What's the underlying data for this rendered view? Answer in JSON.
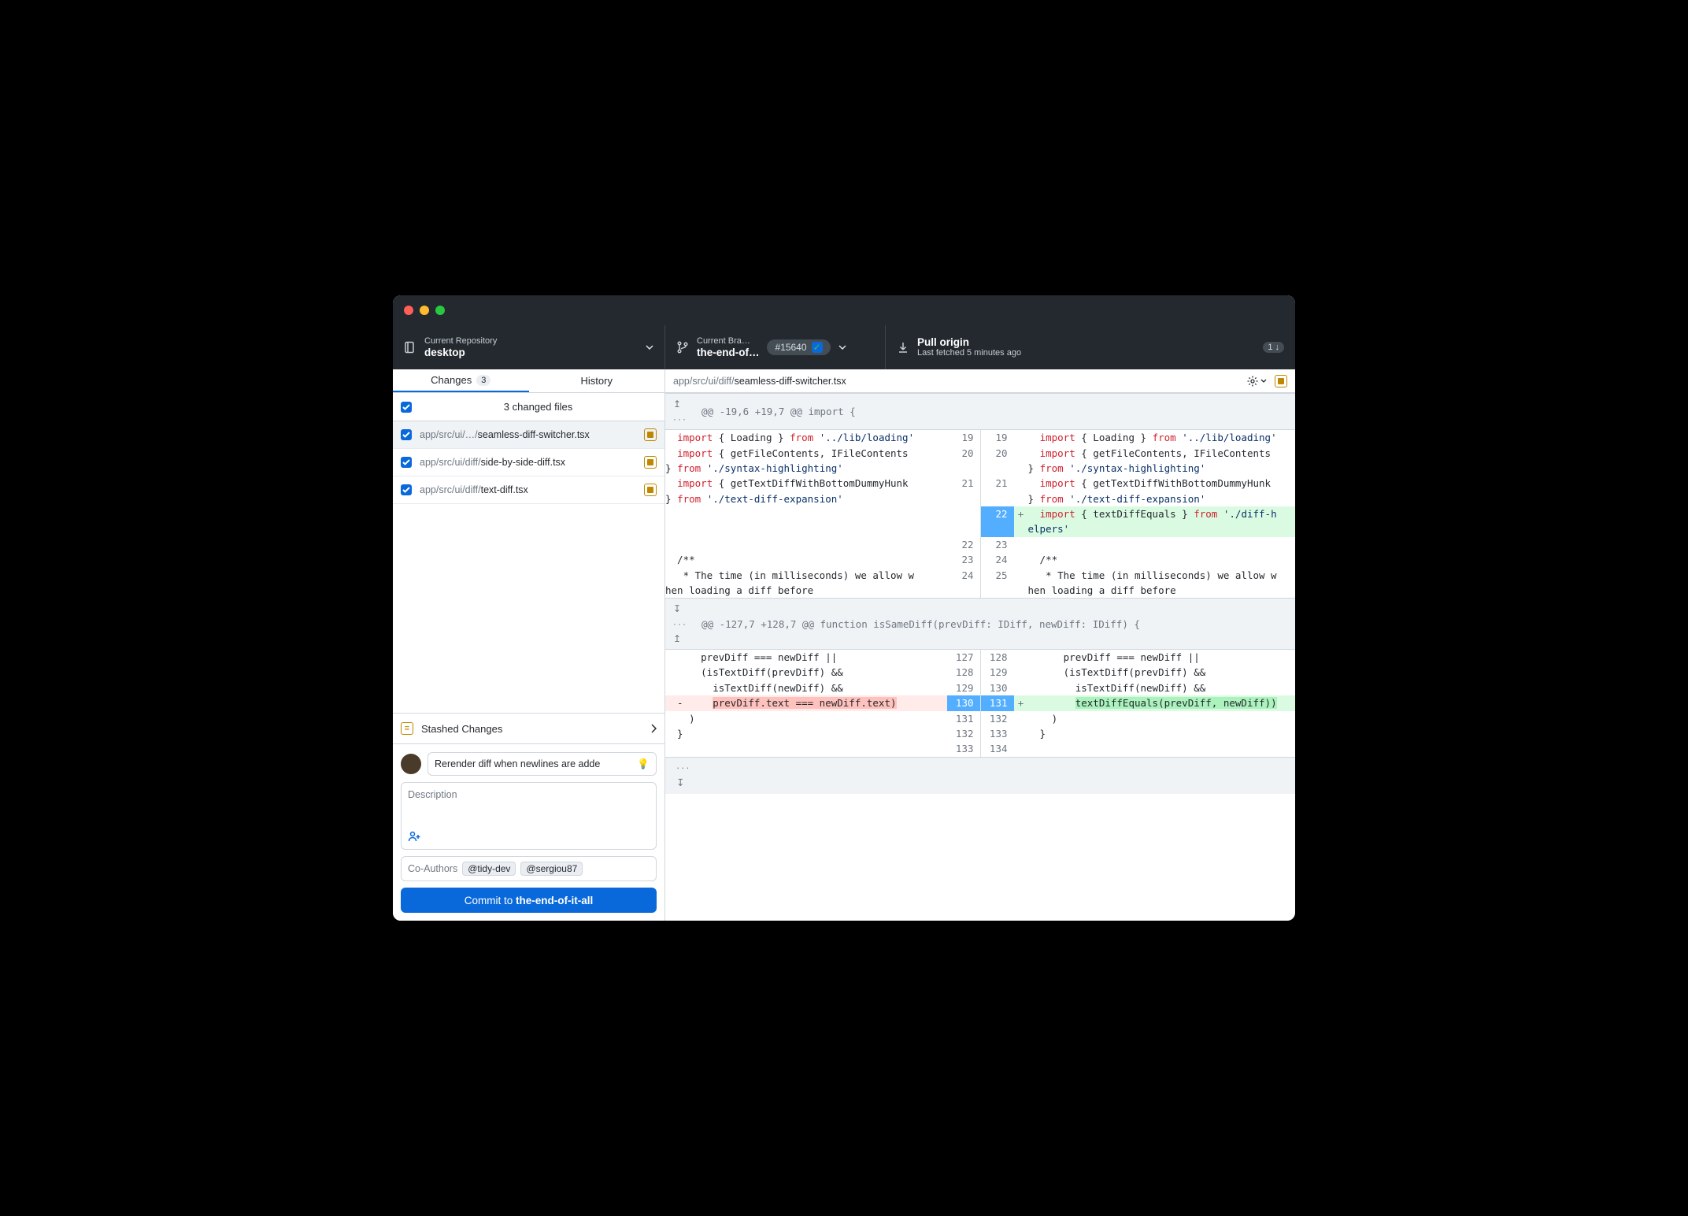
{
  "toolbar": {
    "repo_label": "Current Repository",
    "repo_name": "desktop",
    "branch_label": "Current Bra…",
    "branch_name": "the-end-of…",
    "pr_number": "#15640",
    "pull_label": "Pull origin",
    "pull_sub": "Last fetched 5 minutes ago",
    "pull_badge": "1"
  },
  "tabs": {
    "changes": "Changes",
    "changes_count": "3",
    "history": "History"
  },
  "files": {
    "header": "3 changed files",
    "items": [
      {
        "dir": "app/src/ui/…/",
        "name": "seamless-diff-switcher.tsx"
      },
      {
        "dir": "app/src/ui/diff/",
        "name": "side-by-side-diff.tsx"
      },
      {
        "dir": "app/src/ui/diff/",
        "name": "text-diff.tsx"
      }
    ]
  },
  "stash": "Stashed Changes",
  "commit": {
    "summary": "Rerender diff when newlines are adde",
    "desc_placeholder": "Description",
    "coauthors_label": "Co-Authors",
    "coauthors": [
      "@tidy-dev",
      "@sergiou87"
    ],
    "button_prefix": "Commit to ",
    "button_branch": "the-end-of-it-all"
  },
  "diff": {
    "path_dir": "app/src/ui/diff/",
    "path_file": "seamless-diff-switcher.tsx",
    "hunk1": "@@ -19,6 +19,7 @@ import {",
    "hunk2": "@@ -127,7 +128,7 @@ function isSameDiff(prevDiff: IDiff, newDiff: IDiff) {"
  }
}
